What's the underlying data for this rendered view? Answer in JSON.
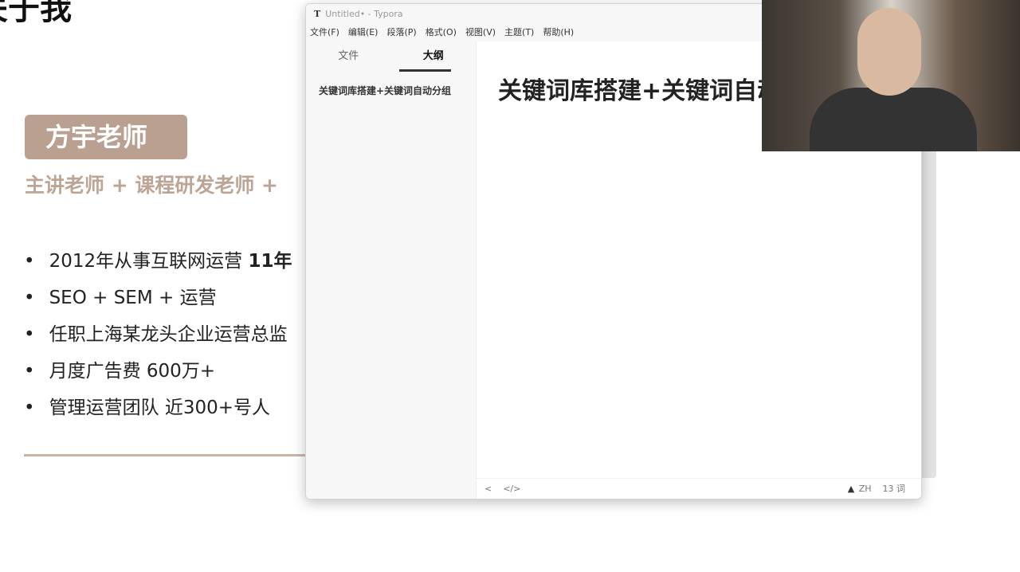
{
  "slide": {
    "title": "关于我",
    "name_badge": "方宇老师",
    "subtitle": "主讲老师 + 课程研发老师 +",
    "bullets": [
      {
        "text": "2012年从事互联网运营 ",
        "bold": "11年"
      },
      {
        "text": "SEO + SEM + 运营",
        "bold": ""
      },
      {
        "text": "任职上海某龙头企业运营总监",
        "bold": ""
      },
      {
        "text": "月度广告费 600万+",
        "bold": ""
      },
      {
        "text": "管理运营团队 近300+号人",
        "bold": ""
      }
    ]
  },
  "window": {
    "app_icon": "T",
    "title": "Untitled• - Typora",
    "menu": [
      "文件(F)",
      "编辑(E)",
      "段落(P)",
      "格式(O)",
      "视图(V)",
      "主题(T)",
      "帮助(H)"
    ],
    "sidebar": {
      "tabs": [
        "文件",
        "大纲"
      ],
      "outline": [
        "关键词库搭建+关键词自动分组"
      ]
    },
    "editor": {
      "heading": "关键词库搭建+关键词自动分组"
    },
    "footer": {
      "back": "<",
      "source": "</>",
      "warning": "▲",
      "lang": "ZH",
      "word_count": "13 词"
    }
  }
}
